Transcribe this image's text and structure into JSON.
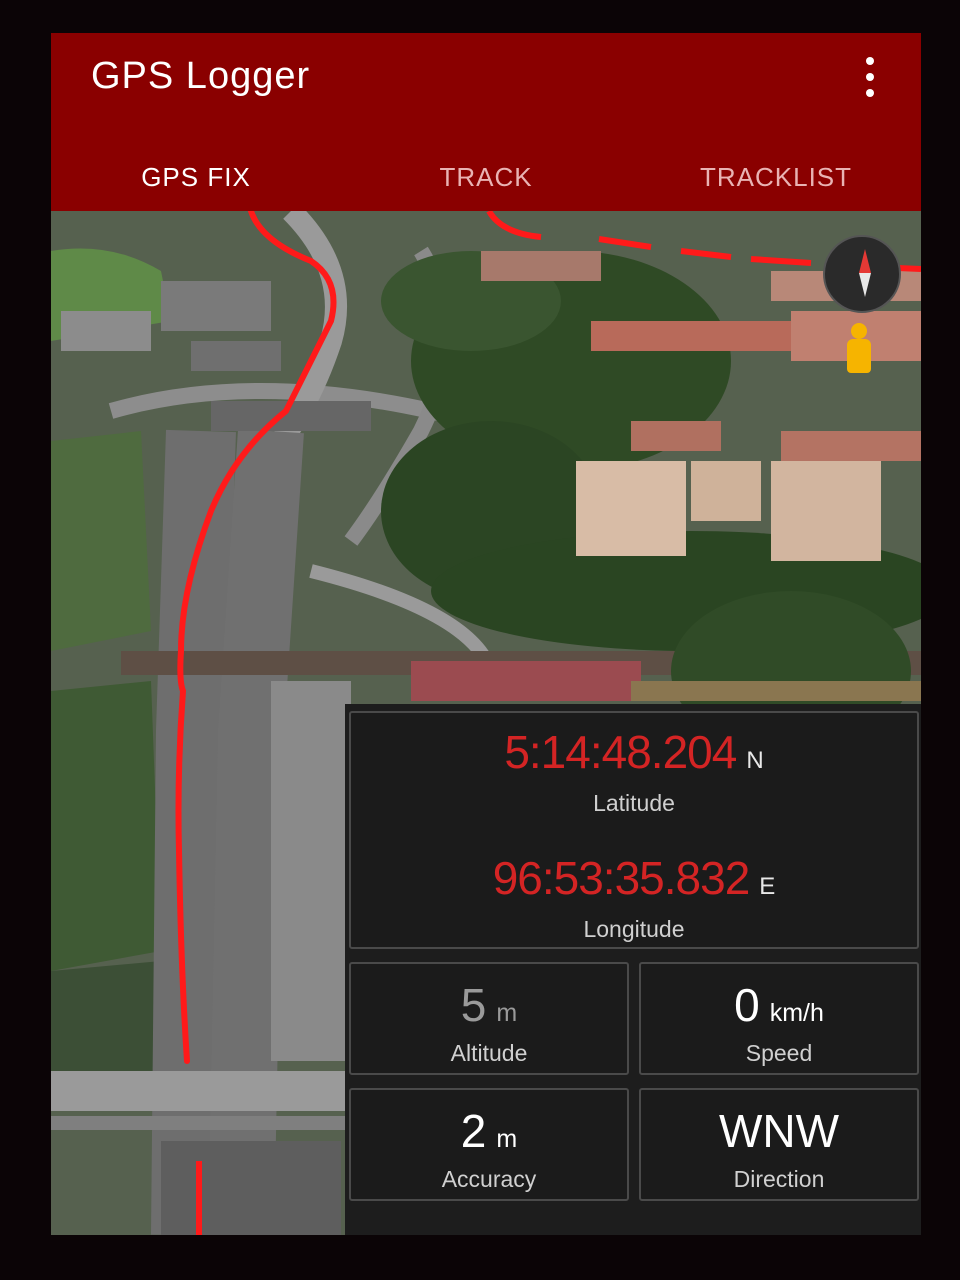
{
  "app": {
    "title": "GPS Logger"
  },
  "menu": {
    "icon": "more-vert-icon"
  },
  "tabs": [
    {
      "label": "GPS FIX",
      "active": true
    },
    {
      "label": "TRACK",
      "active": false
    },
    {
      "label": "TRACKLIST",
      "active": false
    }
  ],
  "map": {
    "compass_icon": "compass-icon",
    "pegman_icon": "street-view-pegman-icon",
    "track_color": "#ff1a1a"
  },
  "gps": {
    "latitude": {
      "value": "5:14:48.204",
      "hemisphere": "N",
      "label": "Latitude"
    },
    "longitude": {
      "value": "96:53:35.832",
      "hemisphere": "E",
      "label": "Longitude"
    },
    "altitude": {
      "value": "5",
      "unit": "m",
      "label": "Altitude"
    },
    "speed": {
      "value": "0",
      "unit": "km/h",
      "label": "Speed"
    },
    "accuracy": {
      "value": "2",
      "unit": "m",
      "label": "Accuracy"
    },
    "direction": {
      "value": "WNW",
      "unit": "",
      "label": "Direction"
    }
  },
  "colors": {
    "appbar": "#8a0000",
    "coordinate_value": "#d42424",
    "panel_background": "#1b1b1b"
  }
}
